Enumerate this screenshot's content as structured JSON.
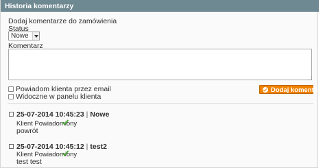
{
  "panel": {
    "title": "Historia komentarzy"
  },
  "form": {
    "add_comment_label": "Dodaj komentarze do zamówienia",
    "status_label": "Status",
    "status_value": "Nowe",
    "comment_label": "Komentarz",
    "comment_value": "",
    "notify_label": "Powiadom klienta przez email",
    "visible_label": "Widoczne w panelu klienta",
    "submit_label": "Dodaj komentarz"
  },
  "history": [
    {
      "datetime": "25-07-2014 10:45:23",
      "status": "Nowe",
      "notified_label": "Klient Powiadomiony",
      "text": "powrót"
    },
    {
      "datetime": "25-07-2014 10:45:12",
      "status": "test2",
      "notified_label": "Klient Powiadomiony",
      "text": "test test"
    }
  ],
  "colors": {
    "header_bg": "#6f8992",
    "button_bg": "#f18200",
    "check": "#4fa83d"
  }
}
